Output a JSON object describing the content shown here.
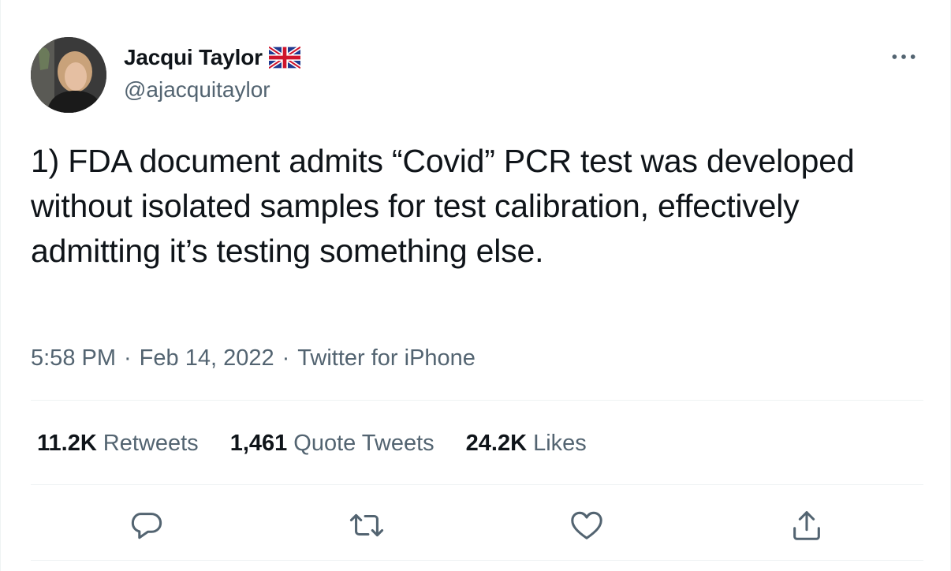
{
  "author": {
    "display_name": "Jacqui Taylor",
    "handle": "@ajacquitaylor",
    "flag_icon": "uk-flag-icon"
  },
  "tweet": {
    "text": "1) FDA document admits “Covid” PCR test was developed without isolated samples for test calibration, effectively admitting it’s testing something else.",
    "time": "5:58 PM",
    "date": "Feb 14, 2022",
    "source": "Twitter for iPhone",
    "separator": "·"
  },
  "stats": {
    "retweets": {
      "count": "11.2K",
      "label": "Retweets"
    },
    "quotes": {
      "count": "1,461",
      "label": "Quote Tweets"
    },
    "likes": {
      "count": "24.2K",
      "label": "Likes"
    }
  },
  "actions": [
    "reply-icon",
    "retweet-icon",
    "like-icon",
    "share-icon"
  ],
  "colors": {
    "text_primary": "#0f1419",
    "text_secondary": "#536471",
    "divider": "#eff3f4"
  }
}
